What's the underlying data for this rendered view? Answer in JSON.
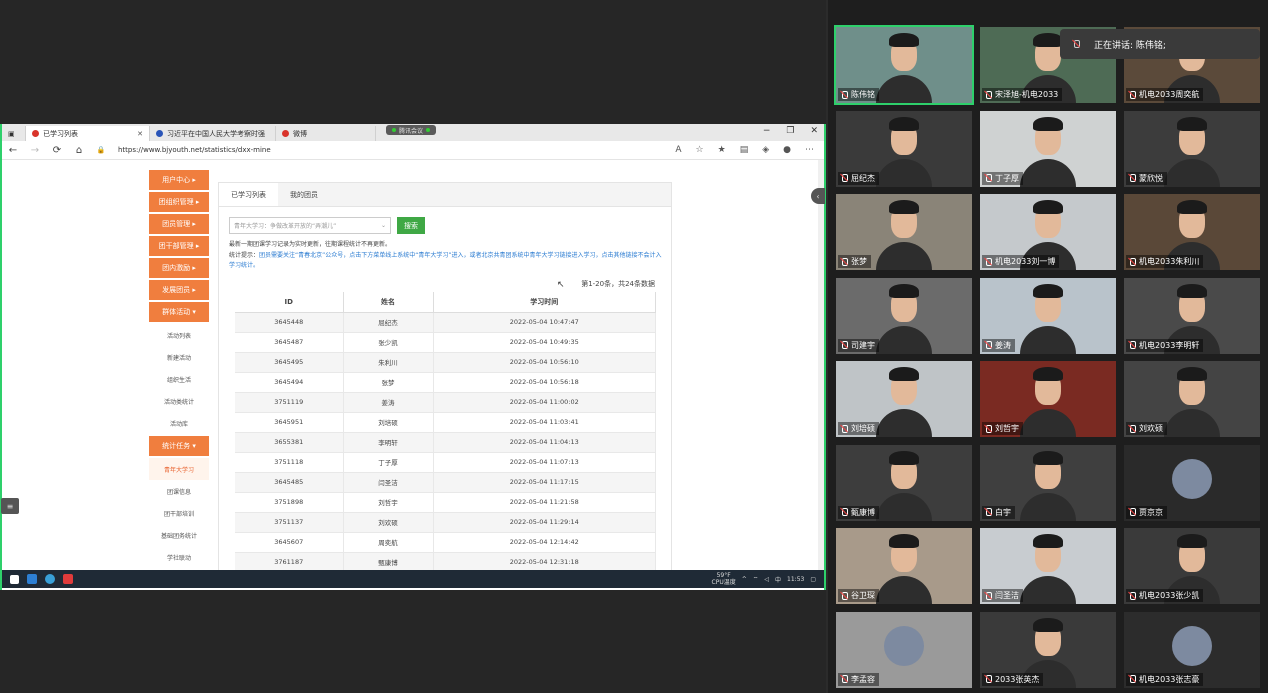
{
  "browser": {
    "tabs": [
      {
        "title": "已学习列表",
        "active": true
      },
      {
        "title": "习近平在中国人民大学考察时强",
        "active": false
      },
      {
        "title": "微博",
        "active": false
      }
    ],
    "meeting_pill": "腾讯会议",
    "url": "https://www.bjyouth.net/statistics/dxx-mine"
  },
  "sidebar": {
    "main_items": [
      "用户中心",
      "团组织管理",
      "团员管理",
      "团干部管理",
      "团内激励",
      "发展团员",
      "群体活动"
    ],
    "activity_sub": [
      "活动列表",
      "新建活动",
      "组织生活",
      "活动类统计",
      "活动库"
    ],
    "stats_item": "统计任务",
    "stats_sub": [
      "青年大学习",
      "团课信息",
      "团干部培训",
      "基础团务统计",
      "学社联动"
    ],
    "active_sub": "青年大学习"
  },
  "content": {
    "tabs": [
      "已学习列表",
      "我的团员"
    ],
    "search_placeholder": "青年大学习：争做改革开放的“弄潮儿”",
    "search_button": "搜索",
    "note1": "最新一期团课学习记录为实时更新，往期课程统计不再更新。",
    "note2_prefix": "统计提示：",
    "note2_body": "团员需要关注“青春北京”公众号，点击下方菜单线上系统中“青年大学习”进入，或者北京共青团系统中青年大学习链接进入学习，点击其他链接不会计入学习统计。",
    "count_text": "第1-20条，共24条数据",
    "table": {
      "headers": [
        "ID",
        "姓名",
        "学习时间"
      ],
      "rows": [
        [
          "3645448",
          "屈纪杰",
          "2022-05-04 10:47:47"
        ],
        [
          "3645487",
          "张少凯",
          "2022-05-04 10:49:35"
        ],
        [
          "3645495",
          "朱利川",
          "2022-05-04 10:56:10"
        ],
        [
          "3645494",
          "张梦",
          "2022-05-04 10:56:18"
        ],
        [
          "3751119",
          "姜涛",
          "2022-05-04 11:00:02"
        ],
        [
          "3645951",
          "刘培硕",
          "2022-05-04 11:03:41"
        ],
        [
          "3655381",
          "李明轩",
          "2022-05-04 11:04:13"
        ],
        [
          "3751118",
          "丁子厚",
          "2022-05-04 11:07:13"
        ],
        [
          "3645485",
          "闫圣洁",
          "2022-05-04 11:17:15"
        ],
        [
          "3751898",
          "刘哲宇",
          "2022-05-04 11:21:58"
        ],
        [
          "3751137",
          "刘欢硕",
          "2022-05-04 11:29:14"
        ],
        [
          "3645607",
          "周奕航",
          "2022-05-04 12:14:42"
        ],
        [
          "3761187",
          "甄康博",
          "2022-05-04 12:31:18"
        ]
      ]
    }
  },
  "taskbar": {
    "weather": "59°F",
    "cpu": "CPU温度",
    "ime": "中",
    "time": "11:53"
  },
  "meeting": {
    "speaking_label": "正在讲话: 陈伟铭;",
    "participants": [
      "陈伟铭",
      "宋泽旭-机电2033",
      "机电2033周奕航",
      "屈纪杰",
      "丁子厚",
      "蒙欣悦",
      "张梦",
      "机电2033刘一博",
      "机电2033朱利川",
      "司建宇",
      "姜涛",
      "机电2033李明轩",
      "刘培硕",
      "刘哲宇",
      "刘欢硕",
      "甄康博",
      "白宇",
      "贾京京",
      "谷卫琛",
      "闫圣洁",
      "机电2033张少凯",
      "李孟容",
      "2033张英杰",
      "机电2033张志豪"
    ],
    "colors": {
      "accent_green": "#2ed06b",
      "nav_orange": "#f07e3e",
      "search_green": "#3fa845"
    }
  }
}
